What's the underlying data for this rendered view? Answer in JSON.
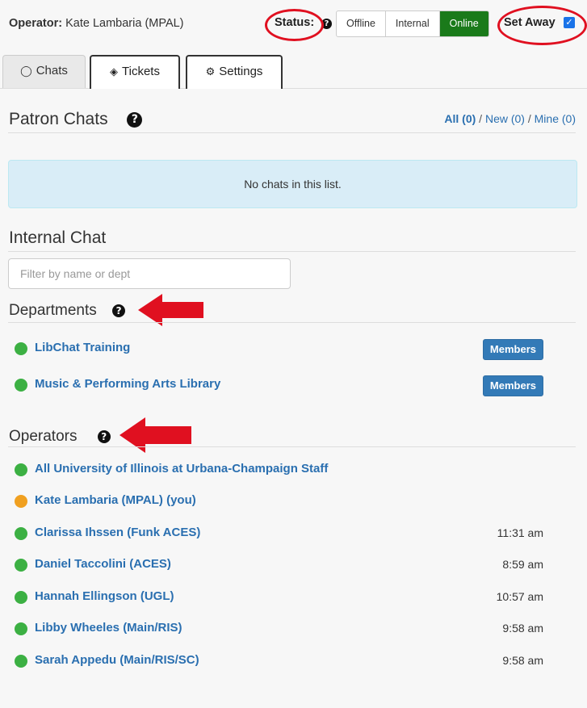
{
  "header": {
    "operator_label": "Operator:",
    "operator_name": "Kate Lambaria (MPAL)",
    "status_label": "Status:",
    "status_options": [
      "Offline",
      "Internal",
      "Online"
    ],
    "active_status": "Online",
    "set_away_label": "Set Away",
    "set_away_checked": true
  },
  "tabs": [
    {
      "label": "Chats",
      "icon": "chat-bubble-icon",
      "active": true
    },
    {
      "label": "Tickets",
      "icon": "ticket-icon",
      "active": false
    },
    {
      "label": "Settings",
      "icon": "gear-icon",
      "active": false
    }
  ],
  "patron_chats": {
    "title": "Patron Chats",
    "filter_all": "All (0)",
    "filter_new": "New (0)",
    "filter_mine": "Mine (0)",
    "separator": "/",
    "empty_message": "No chats in this list."
  },
  "internal_chat": {
    "title": "Internal Chat",
    "filter_placeholder": "Filter by name or dept"
  },
  "departments": {
    "title": "Departments",
    "items": [
      {
        "name": "LibChat Training",
        "status": "green",
        "button": "Members"
      },
      {
        "name": "Music & Performing Arts Library",
        "status": "green",
        "button": "Members"
      }
    ]
  },
  "operators": {
    "title": "Operators",
    "items": [
      {
        "name": "All University of Illinois at Urbana-Champaign Staff",
        "status": "green",
        "time": ""
      },
      {
        "name": "Kate Lambaria (MPAL) (you)",
        "status": "orange",
        "time": ""
      },
      {
        "name": "Clarissa Ihssen (Funk ACES)",
        "status": "green",
        "time": "11:31 am"
      },
      {
        "name": "Daniel Taccolini (ACES)",
        "status": "green",
        "time": "8:59 am"
      },
      {
        "name": "Hannah Ellingson (UGL)",
        "status": "green",
        "time": "10:57 am"
      },
      {
        "name": "Libby Wheeles (Main/RIS)",
        "status": "green",
        "time": "9:58 am"
      },
      {
        "name": "Sarah Appedu (Main/RIS/SC)",
        "status": "green",
        "time": "9:58 am"
      }
    ]
  },
  "colors": {
    "online_green": "#1a7a1a",
    "link_blue": "#2a6fb0",
    "annotation_red": "#e01020",
    "status_green": "#3cb043",
    "status_orange": "#f0a020"
  }
}
